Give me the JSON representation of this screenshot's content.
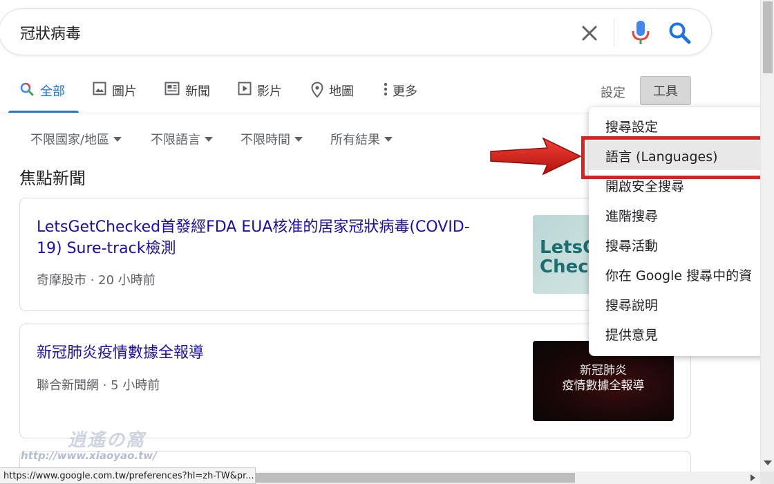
{
  "search": {
    "query": "冠狀病毒",
    "colors": {
      "mic_blue": "#4285f4",
      "mic_red": "#ea4335",
      "search_blue": "#1a73e8"
    }
  },
  "tabs": [
    {
      "label": "全部",
      "icon": "search-icon",
      "active": true
    },
    {
      "label": "圖片",
      "icon": "image-icon"
    },
    {
      "label": "新聞",
      "icon": "news-icon"
    },
    {
      "label": "影片",
      "icon": "video-icon"
    },
    {
      "label": "地圖",
      "icon": "map-pin-icon"
    },
    {
      "label": "更多",
      "icon": "more-vert-icon"
    }
  ],
  "toolbar": {
    "settings_label": "設定",
    "tools_label": "工具"
  },
  "filters": [
    {
      "label": "不限國家/地區"
    },
    {
      "label": "不限語言"
    },
    {
      "label": "不限時間"
    },
    {
      "label": "所有結果"
    }
  ],
  "section_title": "焦點新聞",
  "news": [
    {
      "title_line1": "LetsGetChecked首發經FDA EUA核准的居家冠狀病毒(COVID-",
      "title_line2": "19) Sure-track檢測",
      "source": "奇摩股市",
      "time": "20 小時前",
      "thumb_text": [
        "LetsGe",
        "Check"
      ]
    },
    {
      "title_line1": "新冠肺炎疫情數據全報導",
      "title_line2": "",
      "source": "聯合新聞網",
      "time": "5 小時前",
      "thumb_text": [
        "新冠肺炎",
        "疫情數據全報導"
      ]
    }
  ],
  "dropdown": {
    "items": [
      {
        "label": "搜尋設定"
      },
      {
        "label": "語言 (Languages)",
        "highlighted": true
      },
      {
        "label": "開啟安全搜尋"
      },
      {
        "label": "進階搜尋"
      },
      {
        "label": "搜尋活動"
      },
      {
        "label": "你在 Google 搜尋中的資"
      },
      {
        "label": "搜尋說明"
      },
      {
        "label": "提供意見"
      }
    ],
    "highlight_color": "#e0201e"
  },
  "watermark": {
    "top": "逍遙の窩",
    "url": "http://www.xiaoyao.tw/"
  },
  "status_bar": {
    "url": "https://www.google.com.tw/preferences?hl=zh-TW&pr..."
  }
}
